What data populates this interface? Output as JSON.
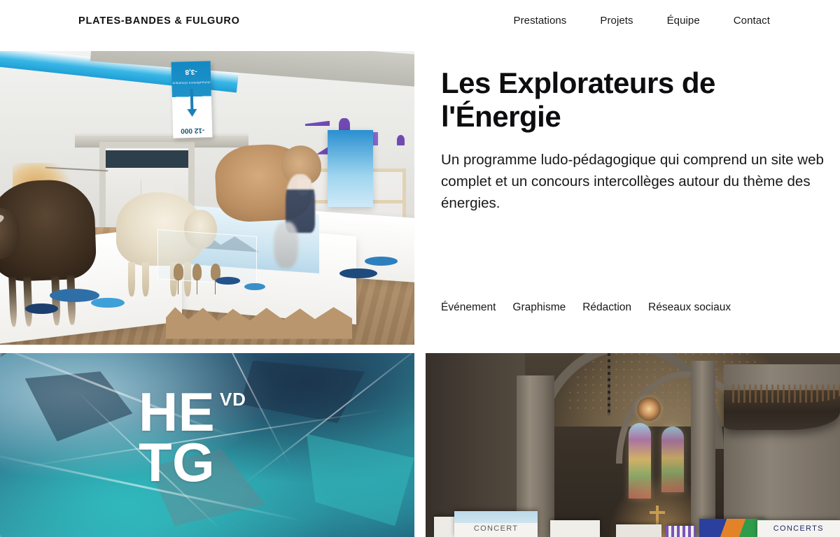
{
  "header": {
    "logo": "PLATES-BANDES & FULGURO",
    "nav": [
      {
        "label": "Prestations"
      },
      {
        "label": "Projets"
      },
      {
        "label": "Équipe"
      },
      {
        "label": "Contact"
      }
    ]
  },
  "project": {
    "title": "Les Explorateurs de l'Énergie",
    "description": "Un programme ludo-pédagogique qui comprend un site web complet et un concours intercollèges autour du thème des énergies.",
    "tags": [
      {
        "label": "Événement"
      },
      {
        "label": "Graphisme"
      },
      {
        "label": "Rédaction"
      },
      {
        "label": "Réseaux sociaux"
      }
    ]
  },
  "tiles": {
    "museum": {
      "alt": "Exposition de musée avec animaux naturalisés sur des socles blancs",
      "sign": {
        "top": "-3,8",
        "sub": "réchauffement climatique",
        "bottom": "-12 000"
      }
    },
    "foil": {
      "alt": "Texture de film métallique froissé turquoise",
      "logo": {
        "line1": "HE",
        "superscript": "VD",
        "line2": "TG"
      }
    },
    "church": {
      "alt": "Intérieur d'église gothique avec vitraux et affiches de concert",
      "posters": [
        {
          "label": ""
        },
        {
          "label": "CONCERT"
        },
        {
          "label": ""
        },
        {
          "label": ""
        },
        {
          "label": ""
        },
        {
          "label": ""
        },
        {
          "label": "CONCERTS"
        }
      ]
    }
  },
  "colors": {
    "text": "#111111",
    "background": "#ffffff",
    "sign_blue": "#1389c4",
    "foil_teal": "#35a7ae",
    "foil_navy": "#1d3b56"
  }
}
